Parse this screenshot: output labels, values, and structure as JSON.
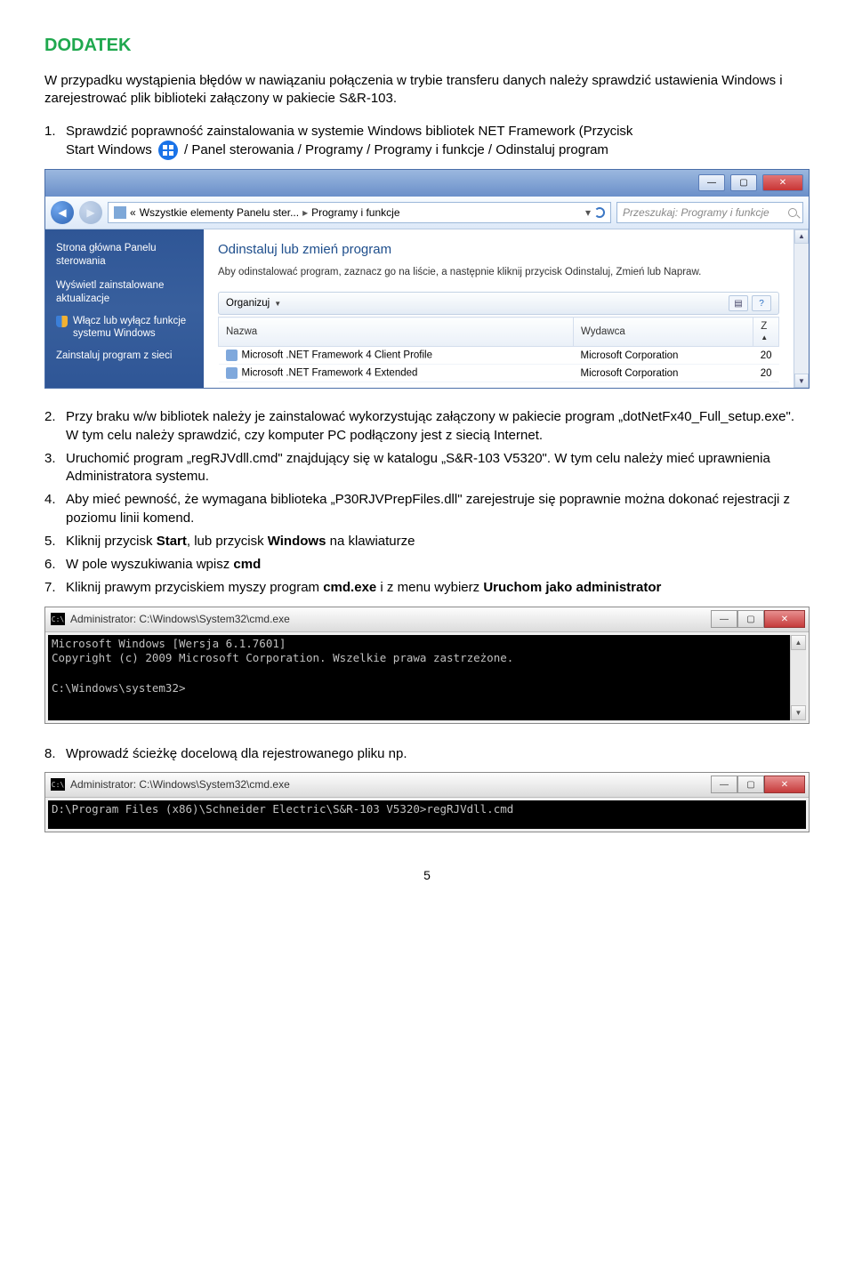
{
  "title": "DODATEK",
  "intro": "W przypadku wystąpienia błędów w nawiązaniu połączenia w trybie transferu danych należy sprawdzić ustawienia Windows i zarejestrować plik biblioteki załączony w pakiecie S&R-103.",
  "step1_a": "Sprawdzić poprawność zainstalowania w systemie Windows bibliotek NET Framework (Przycisk",
  "step1_b": "Start Windows",
  "step1_c": " / Panel sterowania / Programy / Programy i funkcje / Odinstaluj program",
  "cp": {
    "breadcrumb_a": "Wszystkie elementy Panelu ster...",
    "breadcrumb_b": "Programy i funkcje",
    "search_placeholder": "Przeszukaj: Programy i funkcje",
    "sidebar": {
      "home1": "Strona główna Panelu",
      "home2": "sterowania",
      "link1a": "Wyświetl zainstalowane",
      "link1b": "aktualizacje",
      "link2a": "Włącz lub wyłącz funkcje",
      "link2b": "systemu Windows",
      "link3": "Zainstaluj program z sieci"
    },
    "main": {
      "heading": "Odinstaluj lub zmień program",
      "desc": "Aby odinstalować program, zaznacz go na liście, a następnie kliknij przycisk Odinstaluj, Zmień lub Napraw.",
      "organize": "Organizuj",
      "col_name": "Nazwa",
      "col_publisher": "Wydawca",
      "col_z": "Z",
      "row1_name": "Microsoft .NET Framework 4 Client Profile",
      "row1_pub": "Microsoft Corporation",
      "row1_z": "20",
      "row2_name": "Microsoft .NET Framework 4 Extended",
      "row2_pub": "Microsoft Corporation",
      "row2_z": "20"
    }
  },
  "step2": "Przy braku w/w bibliotek należy je zainstalować wykorzystując załączony w pakiecie program „dotNetFx40_Full_setup.exe\". W tym celu należy sprawdzić, czy komputer PC podłączony jest z siecią Internet.",
  "step3": "Uruchomić program „regRJVdll.cmd\" znajdujący się w katalogu „S&R-103 V5320\". W tym celu należy mieć uprawnienia Administratora systemu.",
  "step4": "Aby mieć pewność, że wymagana biblioteka „P30RJVPrepFiles.dll\" zarejestruje się poprawnie można dokonać rejestracji z poziomu linii komend.",
  "step5_a": "Kliknij przycisk ",
  "step5_b": "Start",
  "step5_c": ", lub przycisk ",
  "step5_d": "Windows",
  "step5_e": " na klawiaturze",
  "step6_a": "W pole wyszukiwania wpisz ",
  "step6_b": "cmd",
  "step7_a": "Kliknij prawym przyciskiem myszy program ",
  "step7_b": "cmd.exe",
  "step7_c": " i z menu wybierz ",
  "step7_d": "Uruchom jako administrator",
  "cmd1": {
    "title": "Administrator: C:\\Windows\\System32\\cmd.exe",
    "line1": "Microsoft Windows [Wersja 6.1.7601]",
    "line2": "Copyright (c) 2009 Microsoft Corporation. Wszelkie prawa zastrzeżone.",
    "line3": "",
    "line4": "C:\\Windows\\system32>"
  },
  "step8": "Wprowadź ścieżkę docelową dla rejestrowanego pliku np.",
  "cmd2": {
    "title": "Administrator: C:\\Windows\\System32\\cmd.exe",
    "line1": "D:\\Program Files (x86)\\Schneider Electric\\S&R-103 V5320>regRJVdll.cmd"
  },
  "page": "5"
}
